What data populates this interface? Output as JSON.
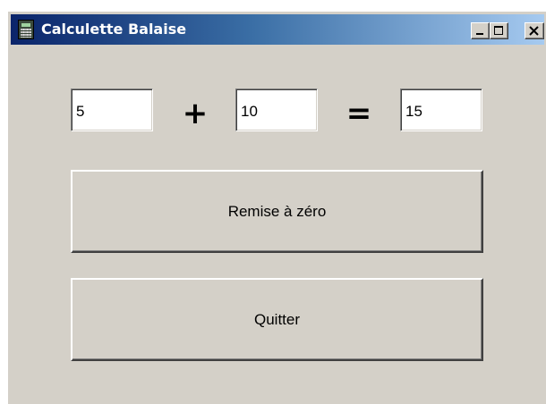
{
  "window": {
    "title": "Calculette Balaise",
    "icon": "calculator-icon",
    "controls": [
      "minimize-icon",
      "maximize-icon",
      "close-icon"
    ]
  },
  "calculator": {
    "operand1": "5",
    "operator": "+",
    "operand2": "10",
    "equals": "=",
    "result": "15"
  },
  "buttons": {
    "reset_label": "Remise à zéro",
    "quit_label": "Quitter"
  },
  "colors": {
    "titlebar_start": "#0a246a",
    "titlebar_end": "#a6caf0",
    "face": "#d4d0c8"
  }
}
